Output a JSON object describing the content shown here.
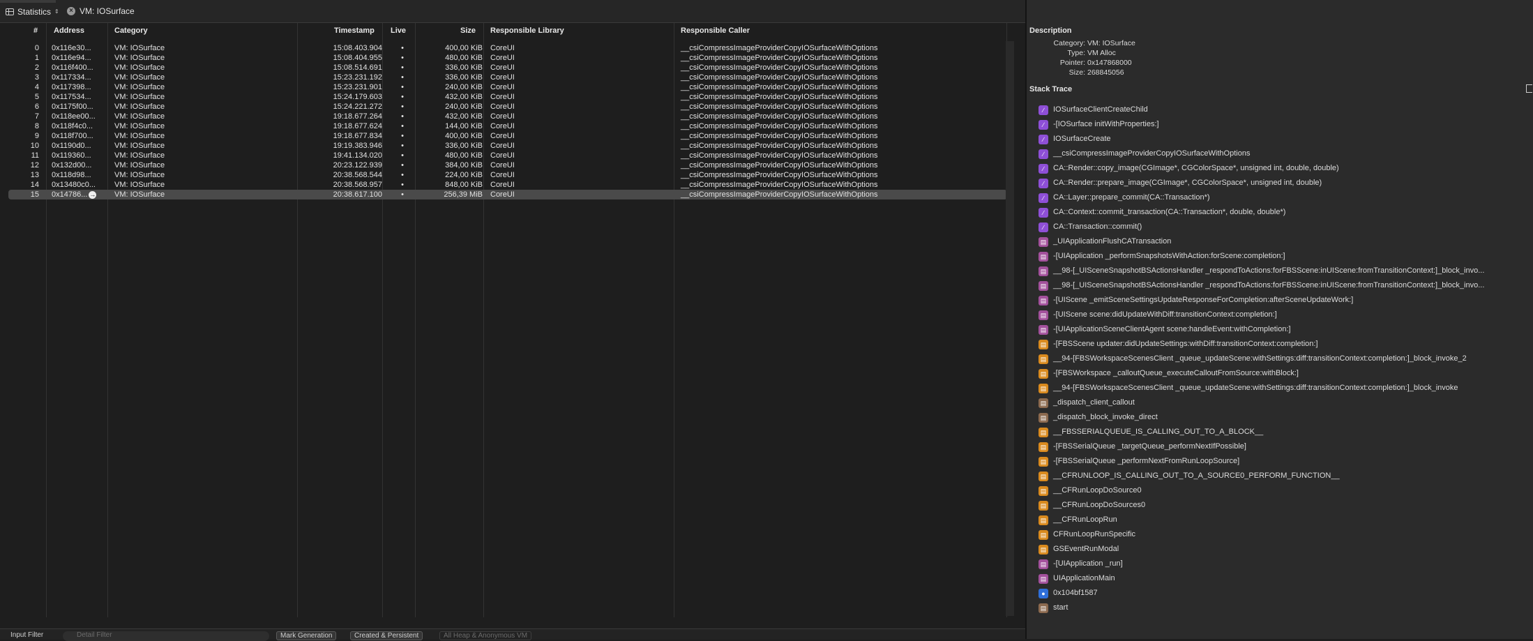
{
  "toolbar": {
    "view_label": "Statistics",
    "filter_label": "VM: IOSurface"
  },
  "table": {
    "headers": {
      "num": "#",
      "address": "Address",
      "category": "Category",
      "timestamp": "Timestamp",
      "live": "Live",
      "size": "Size",
      "library": "Responsible Library",
      "caller": "Responsible Caller"
    },
    "rows": [
      {
        "num": "0",
        "address": "0x116e30...",
        "category": "VM: IOSurface",
        "timestamp": "15:08.403.904",
        "live": "•",
        "size": "400,00 KiB",
        "library": "CoreUI",
        "caller": "__csiCompressImageProviderCopyIOSurfaceWithOptions"
      },
      {
        "num": "1",
        "address": "0x116e94...",
        "category": "VM: IOSurface",
        "timestamp": "15:08.404.955",
        "live": "•",
        "size": "480,00 KiB",
        "library": "CoreUI",
        "caller": "__csiCompressImageProviderCopyIOSurfaceWithOptions"
      },
      {
        "num": "2",
        "address": "0x116f400...",
        "category": "VM: IOSurface",
        "timestamp": "15:08.514.691",
        "live": "•",
        "size": "336,00 KiB",
        "library": "CoreUI",
        "caller": "__csiCompressImageProviderCopyIOSurfaceWithOptions"
      },
      {
        "num": "3",
        "address": "0x117334...",
        "category": "VM: IOSurface",
        "timestamp": "15:23.231.192",
        "live": "•",
        "size": "336,00 KiB",
        "library": "CoreUI",
        "caller": "__csiCompressImageProviderCopyIOSurfaceWithOptions"
      },
      {
        "num": "4",
        "address": "0x117398...",
        "category": "VM: IOSurface",
        "timestamp": "15:23.231.901",
        "live": "•",
        "size": "240,00 KiB",
        "library": "CoreUI",
        "caller": "__csiCompressImageProviderCopyIOSurfaceWithOptions"
      },
      {
        "num": "5",
        "address": "0x117534...",
        "category": "VM: IOSurface",
        "timestamp": "15:24.179.603",
        "live": "•",
        "size": "432,00 KiB",
        "library": "CoreUI",
        "caller": "__csiCompressImageProviderCopyIOSurfaceWithOptions"
      },
      {
        "num": "6",
        "address": "0x1175f00...",
        "category": "VM: IOSurface",
        "timestamp": "15:24.221.272",
        "live": "•",
        "size": "240,00 KiB",
        "library": "CoreUI",
        "caller": "__csiCompressImageProviderCopyIOSurfaceWithOptions"
      },
      {
        "num": "7",
        "address": "0x118ee00...",
        "category": "VM: IOSurface",
        "timestamp": "19:18.677.264",
        "live": "•",
        "size": "432,00 KiB",
        "library": "CoreUI",
        "caller": "__csiCompressImageProviderCopyIOSurfaceWithOptions"
      },
      {
        "num": "8",
        "address": "0x118f4c0...",
        "category": "VM: IOSurface",
        "timestamp": "19:18.677.624",
        "live": "•",
        "size": "144,00 KiB",
        "library": "CoreUI",
        "caller": "__csiCompressImageProviderCopyIOSurfaceWithOptions"
      },
      {
        "num": "9",
        "address": "0x118f700...",
        "category": "VM: IOSurface",
        "timestamp": "19:18.677.834",
        "live": "•",
        "size": "400,00 KiB",
        "library": "CoreUI",
        "caller": "__csiCompressImageProviderCopyIOSurfaceWithOptions"
      },
      {
        "num": "10",
        "address": "0x1190d0...",
        "category": "VM: IOSurface",
        "timestamp": "19:19.383.946",
        "live": "•",
        "size": "336,00 KiB",
        "library": "CoreUI",
        "caller": "__csiCompressImageProviderCopyIOSurfaceWithOptions"
      },
      {
        "num": "11",
        "address": "0x119360...",
        "category": "VM: IOSurface",
        "timestamp": "19:41.134.020",
        "live": "•",
        "size": "480,00 KiB",
        "library": "CoreUI",
        "caller": "__csiCompressImageProviderCopyIOSurfaceWithOptions"
      },
      {
        "num": "12",
        "address": "0x132d00...",
        "category": "VM: IOSurface",
        "timestamp": "20:23.122.939",
        "live": "•",
        "size": "384,00 KiB",
        "library": "CoreUI",
        "caller": "__csiCompressImageProviderCopyIOSurfaceWithOptions"
      },
      {
        "num": "13",
        "address": "0x118d98...",
        "category": "VM: IOSurface",
        "timestamp": "20:38.568.544",
        "live": "•",
        "size": "224,00 KiB",
        "library": "CoreUI",
        "caller": "__csiCompressImageProviderCopyIOSurfaceWithOptions"
      },
      {
        "num": "14",
        "address": "0x13480c0...",
        "category": "VM: IOSurface",
        "timestamp": "20:38.568.957",
        "live": "•",
        "size": "848,00 KiB",
        "library": "CoreUI",
        "caller": "__csiCompressImageProviderCopyIOSurfaceWithOptions"
      },
      {
        "num": "15",
        "address": "0x14786...",
        "category": "VM: IOSurface",
        "timestamp": "20:38.617.100",
        "live": "•",
        "size": "256,39 MiB",
        "library": "CoreUI",
        "caller": "__csiCompressImageProviderCopyIOSurfaceWithOptions",
        "selected": true
      }
    ]
  },
  "bottom": {
    "input_filter": "Input Filter",
    "detail_filter": "Detail Filter",
    "mark_generation": "Mark Generation",
    "created_persistent": "Created & Persistent",
    "all_heap": "All Heap & Anonymous VM"
  },
  "description": {
    "title": "Description",
    "fields": [
      {
        "key": "Category:",
        "value": "VM: IOSurface"
      },
      {
        "key": "Type:",
        "value": "VM Alloc"
      },
      {
        "key": "Pointer:",
        "value": "0x147868000"
      },
      {
        "key": "Size:",
        "value": "268845056"
      }
    ]
  },
  "stack_trace": {
    "title": "Stack Trace",
    "colors": {
      "purple": "#8e4fd6",
      "pink": "#a3519c",
      "orange": "#d98a1e",
      "tan": "#8c6a4f",
      "blue": "#2f6fd9"
    },
    "frames": [
      {
        "label": "IOSurfaceClientCreateChild",
        "icon": "purple"
      },
      {
        "label": "-[IOSurface initWithProperties:]",
        "icon": "purple"
      },
      {
        "label": "IOSurfaceCreate",
        "icon": "purple"
      },
      {
        "label": "__csiCompressImageProviderCopyIOSurfaceWithOptions",
        "icon": "purple"
      },
      {
        "label": "CA::Render::copy_image(CGImage*, CGColorSpace*, unsigned int, double, double)",
        "icon": "purple"
      },
      {
        "label": "CA::Render::prepare_image(CGImage*, CGColorSpace*, unsigned int, double)",
        "icon": "purple"
      },
      {
        "label": "CA::Layer::prepare_commit(CA::Transaction*)",
        "icon": "purple"
      },
      {
        "label": "CA::Context::commit_transaction(CA::Transaction*, double, double*)",
        "icon": "purple"
      },
      {
        "label": "CA::Transaction::commit()",
        "icon": "purple"
      },
      {
        "label": "_UIApplicationFlushCATransaction",
        "icon": "pink"
      },
      {
        "label": "-[UIApplication _performSnapshotsWithAction:forScene:completion:]",
        "icon": "pink"
      },
      {
        "label": "__98-[_UISceneSnapshotBSActionsHandler _respondToActions:forFBSScene:inUIScene:fromTransitionContext:]_block_invo...",
        "icon": "pink"
      },
      {
        "label": "__98-[_UISceneSnapshotBSActionsHandler _respondToActions:forFBSScene:inUIScene:fromTransitionContext:]_block_invo...",
        "icon": "pink"
      },
      {
        "label": "-[UIScene _emitSceneSettingsUpdateResponseForCompletion:afterSceneUpdateWork:]",
        "icon": "pink"
      },
      {
        "label": "-[UIScene scene:didUpdateWithDiff:transitionContext:completion:]",
        "icon": "pink"
      },
      {
        "label": "-[UIApplicationSceneClientAgent scene:handleEvent:withCompletion:]",
        "icon": "pink"
      },
      {
        "label": "-[FBSScene updater:didUpdateSettings:withDiff:transitionContext:completion:]",
        "icon": "orange"
      },
      {
        "label": "__94-[FBSWorkspaceScenesClient _queue_updateScene:withSettings:diff:transitionContext:completion:]_block_invoke_2",
        "icon": "orange"
      },
      {
        "label": "-[FBSWorkspace _calloutQueue_executeCalloutFromSource:withBlock:]",
        "icon": "orange"
      },
      {
        "label": "__94-[FBSWorkspaceScenesClient _queue_updateScene:withSettings:diff:transitionContext:completion:]_block_invoke",
        "icon": "orange"
      },
      {
        "label": "_dispatch_client_callout",
        "icon": "tan"
      },
      {
        "label": "_dispatch_block_invoke_direct",
        "icon": "tan"
      },
      {
        "label": "__FBSSERIALQUEUE_IS_CALLING_OUT_TO_A_BLOCK__",
        "icon": "orange"
      },
      {
        "label": "-[FBSSerialQueue _targetQueue_performNextIfPossible]",
        "icon": "orange"
      },
      {
        "label": "-[FBSSerialQueue _performNextFromRunLoopSource]",
        "icon": "orange"
      },
      {
        "label": "__CFRUNLOOP_IS_CALLING_OUT_TO_A_SOURCE0_PERFORM_FUNCTION__",
        "icon": "orange"
      },
      {
        "label": "__CFRunLoopDoSource0",
        "icon": "orange"
      },
      {
        "label": "__CFRunLoopDoSources0",
        "icon": "orange"
      },
      {
        "label": "__CFRunLoopRun",
        "icon": "orange"
      },
      {
        "label": "CFRunLoopRunSpecific",
        "icon": "orange"
      },
      {
        "label": "GSEventRunModal",
        "icon": "orange"
      },
      {
        "label": "-[UIApplication _run]",
        "icon": "pink"
      },
      {
        "label": "UIApplicationMain",
        "icon": "pink"
      },
      {
        "label": "0x104bf1587",
        "icon": "blue"
      },
      {
        "label": "start",
        "icon": "tan"
      }
    ]
  }
}
